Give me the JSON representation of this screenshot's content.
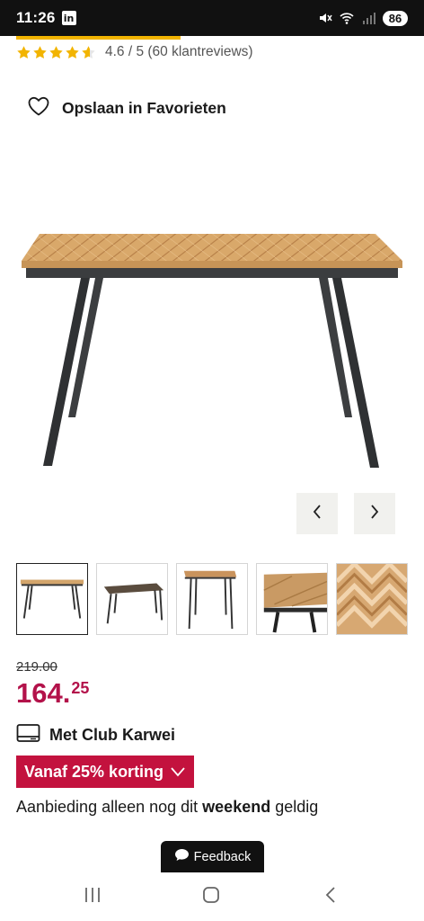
{
  "status_bar": {
    "time": "11:26",
    "app_badge": "in",
    "battery": "86"
  },
  "rating": {
    "stars_value": 4.6,
    "text": "4.6 / 5 (60 klantreviews)",
    "star_color": "#f2b400"
  },
  "favorites": {
    "label": "Opslaan in Favorieten"
  },
  "gallery": {
    "thumbnail_count": 5,
    "active_index": 0
  },
  "price": {
    "old": "219.00",
    "main": "164.",
    "cents": "25",
    "color": "#b3124a"
  },
  "club": {
    "label": "Met Club Karwei"
  },
  "discount": {
    "label": "Vanaf 25% korting",
    "color": "#c3123e"
  },
  "offer": {
    "prefix": "Aanbieding alleen nog dit ",
    "highlight": "weekend",
    "suffix": " geldig"
  },
  "feedback": {
    "label": "Feedback"
  }
}
